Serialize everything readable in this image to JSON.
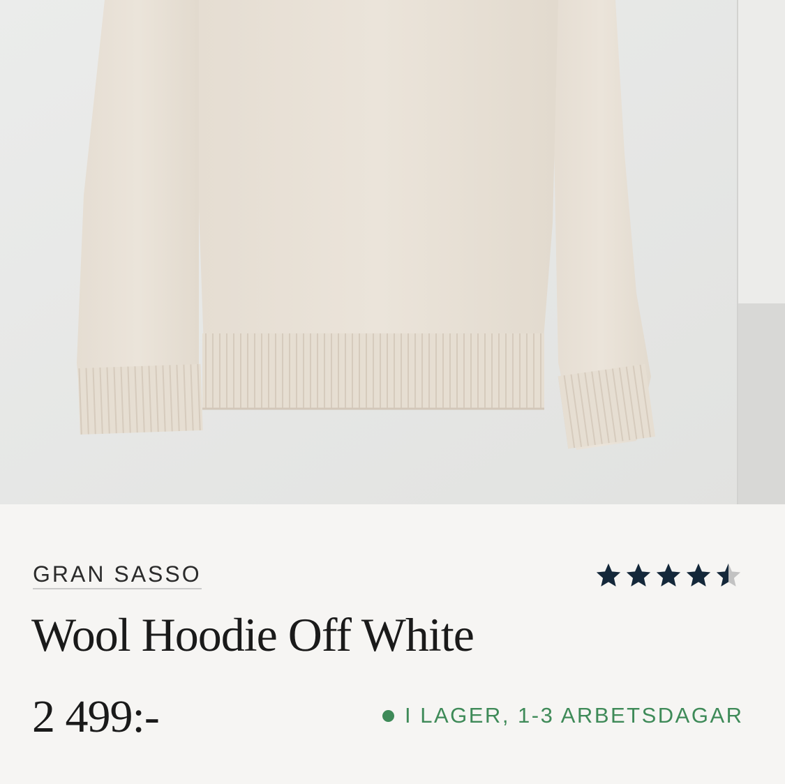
{
  "product_image": {
    "alt_icon": "sweater-product-photo"
  },
  "product": {
    "brand": "GRAN SASSO",
    "title": "Wool Hoodie Off White",
    "price": "2 499:-",
    "rating": 4.5,
    "rating_max": 5,
    "stock_status": "I LAGER, 1-3 ARBETSDAGAR"
  },
  "colors": {
    "star_filled": "#14283a",
    "star_empty": "#c2c2c2",
    "stock_green": "#3e8a58"
  }
}
